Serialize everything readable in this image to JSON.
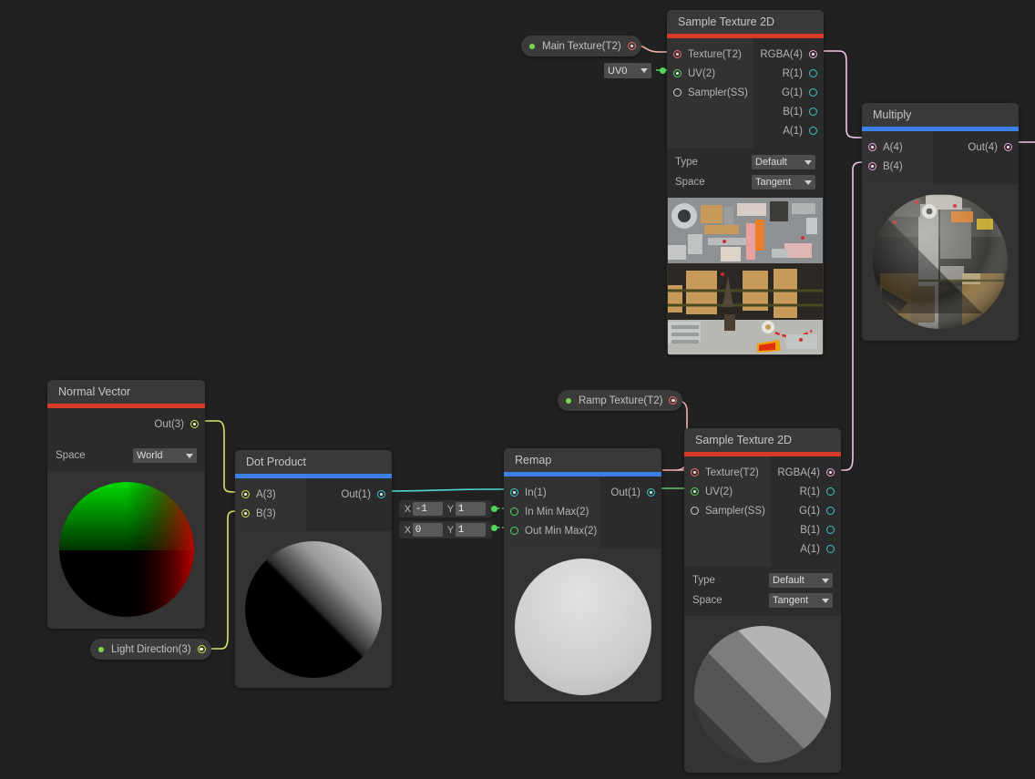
{
  "graph": {
    "background_color": "#212121",
    "wire_colors": {
      "texture2d": "#f2b0b0",
      "vector4": "#f3c6e8",
      "vector2_uv": "#62c76e",
      "vector3": "#dbe26a",
      "float": "#4fd8d3"
    }
  },
  "nodes": {
    "main_texture_property": {
      "label": "Main Texture(T2)",
      "lead_dot_color": "#7dd84a",
      "out_port_type": "texture2d"
    },
    "uv0_node": {
      "value": "UV0",
      "out_port_type": "vector2_uv"
    },
    "sample_texture_top": {
      "title": "Sample Texture 2D",
      "accent_color": "#d83a2a",
      "inputs": [
        {
          "label": "Texture(T2)",
          "type": "texture2d",
          "connected": true
        },
        {
          "label": "UV(2)",
          "type": "vector2_uv",
          "connected": true
        },
        {
          "label": "Sampler(SS)",
          "type": "sampler",
          "connected": false
        }
      ],
      "outputs": [
        {
          "label": "RGBA(4)",
          "type": "vector4",
          "connected": true
        },
        {
          "label": "R(1)",
          "type": "float",
          "connected": false
        },
        {
          "label": "G(1)",
          "type": "float",
          "connected": false
        },
        {
          "label": "B(1)",
          "type": "float",
          "connected": false
        },
        {
          "label": "A(1)",
          "type": "float",
          "connected": false
        }
      ],
      "settings": [
        {
          "label": "Type",
          "value": "Default"
        },
        {
          "label": "Space",
          "value": "Tangent"
        }
      ],
      "preview": "texture-atlas"
    },
    "multiply": {
      "title": "Multiply",
      "accent_color": "#3d7fe8",
      "inputs": [
        {
          "label": "A(4)",
          "type": "vector4",
          "connected": true
        },
        {
          "label": "B(4)",
          "type": "vector4",
          "connected": true
        }
      ],
      "outputs": [
        {
          "label": "Out(4)",
          "type": "vector4",
          "connected": true
        }
      ],
      "settings": [],
      "preview": "sphere-textured-lit"
    },
    "normal_vector": {
      "title": "Normal Vector",
      "accent_color": "#d83a2a",
      "inputs": [],
      "outputs": [
        {
          "label": "Out(3)",
          "type": "vector3",
          "connected": true
        }
      ],
      "settings": [
        {
          "label": "Space",
          "value": "World"
        }
      ],
      "preview": "sphere-normal-rgb"
    },
    "light_direction_property": {
      "label": "Light Direction(3)",
      "lead_dot_color": "#7dd84a",
      "out_port_type": "vector3"
    },
    "dot_product": {
      "title": "Dot Product",
      "accent_color": "#3d7fe8",
      "inputs": [
        {
          "label": "A(3)",
          "type": "vector3",
          "connected": true
        },
        {
          "label": "B(3)",
          "type": "vector3",
          "connected": true
        }
      ],
      "outputs": [
        {
          "label": "Out(1)",
          "type": "float",
          "connected": true
        }
      ],
      "settings": [],
      "preview": "sphere-halflit"
    },
    "remap": {
      "title": "Remap",
      "accent_color": "#3d7fe8",
      "inputs": [
        {
          "label": "In(1)",
          "type": "float",
          "connected": true
        },
        {
          "label": "In Min Max(2)",
          "type": "vector2_uv",
          "connected": false
        },
        {
          "label": "Out Min Max(2)",
          "type": "vector2_uv",
          "connected": false
        }
      ],
      "outputs": [
        {
          "label": "Out(1)",
          "type": "float",
          "connected": true
        }
      ],
      "vector_fields": [
        {
          "axis_x": "X",
          "x": "-1",
          "axis_y": "Y",
          "y": "1"
        },
        {
          "axis_x": "X",
          "x": "0",
          "axis_y": "Y",
          "y": "1"
        }
      ],
      "settings": [],
      "preview": "sphere-flatgray"
    },
    "ramp_texture_property": {
      "label": "Ramp Texture(T2)",
      "lead_dot_color": "#7dd84a",
      "out_port_type": "texture2d"
    },
    "sample_texture_bottom": {
      "title": "Sample Texture 2D",
      "accent_color": "#d83a2a",
      "inputs": [
        {
          "label": "Texture(T2)",
          "type": "texture2d",
          "connected": true
        },
        {
          "label": "UV(2)",
          "type": "vector2_uv",
          "connected": true
        },
        {
          "label": "Sampler(SS)",
          "type": "sampler",
          "connected": false
        }
      ],
      "outputs": [
        {
          "label": "RGBA(4)",
          "type": "vector4",
          "connected": true
        },
        {
          "label": "R(1)",
          "type": "float",
          "connected": false
        },
        {
          "label": "G(1)",
          "type": "float",
          "connected": false
        },
        {
          "label": "B(1)",
          "type": "float",
          "connected": false
        },
        {
          "label": "A(1)",
          "type": "float",
          "connected": false
        }
      ],
      "settings": [
        {
          "label": "Type",
          "value": "Default"
        },
        {
          "label": "Space",
          "value": "Tangent"
        }
      ],
      "preview": "sphere-banded-gray"
    }
  }
}
